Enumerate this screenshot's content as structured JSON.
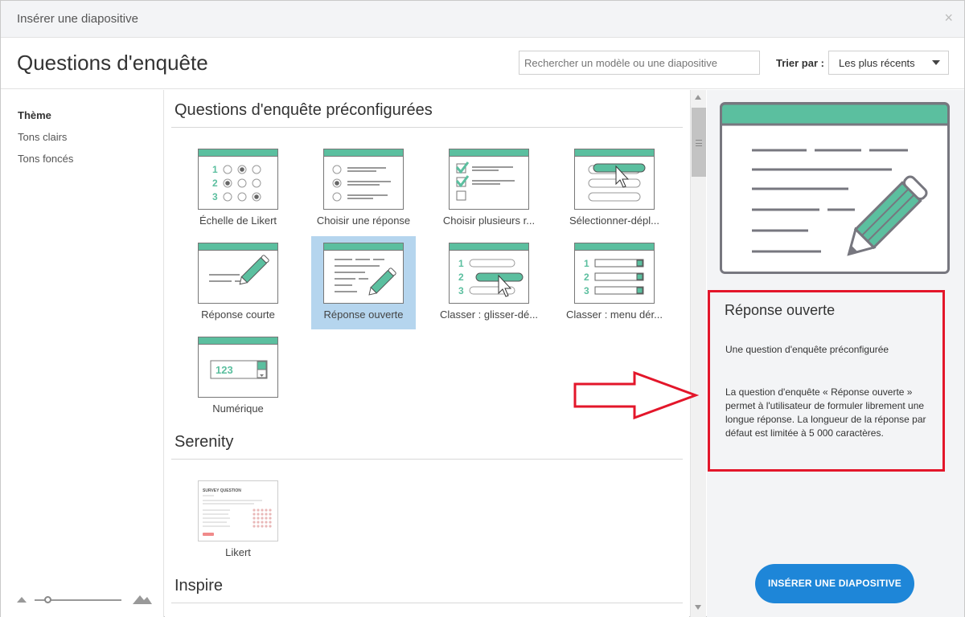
{
  "window": {
    "title": "Insérer une diapositive",
    "close_icon": "×"
  },
  "header": {
    "title": "Questions d'enquête",
    "search_placeholder": "Rechercher un modèle ou une diapositive",
    "sort_label": "Trier par :",
    "sort_value": "Les plus récents"
  },
  "sidebar": {
    "items": [
      "Thème",
      "Tons clairs",
      "Tons foncés"
    ],
    "active": "Thème"
  },
  "sections": [
    {
      "title": "Questions d'enquête préconfigurées"
    },
    {
      "title": "Serenity"
    },
    {
      "title": "Inspire"
    }
  ],
  "templates": [
    {
      "label": "Échelle de Likert",
      "icon": "likert-scale-icon"
    },
    {
      "label": "Choisir une réponse",
      "icon": "single-choice-icon"
    },
    {
      "label": "Choisir plusieurs r...",
      "icon": "multiple-choice-icon"
    },
    {
      "label": "Sélectionner-dépl...",
      "icon": "select-drag-icon"
    },
    {
      "label": "Réponse courte",
      "icon": "short-answer-icon"
    },
    {
      "label": "Réponse ouverte",
      "icon": "open-answer-icon",
      "selected": true
    },
    {
      "label": "Classer : glisser-dé...",
      "icon": "rank-drag-icon"
    },
    {
      "label": "Classer : menu dér...",
      "icon": "rank-dropdown-icon"
    },
    {
      "label": "Numérique",
      "icon": "numeric-icon",
      "thumb_value": "123"
    }
  ],
  "serenity_templates": [
    {
      "label": "Likert",
      "icon": "likert-slide-thumbnail",
      "thumb_title": "SURVEY QUESTION"
    }
  ],
  "preview": {
    "title": "Réponse ouverte",
    "subtitle": "Une question d'enquête préconfigurée",
    "description": "La question d'enquête « Réponse ouverte » permet à l'utilisateur de formuler librement une longue réponse. La longueur de la réponse par défaut est limitée à 5 000 caractères.",
    "insert_label": "INSÉRER UNE DIAPOSITIVE"
  },
  "colors": {
    "accent_green": "#5bbf9f",
    "button_blue": "#1e86d8",
    "highlight_red": "#e3162a",
    "selected_tile": "#b5d5ee"
  }
}
